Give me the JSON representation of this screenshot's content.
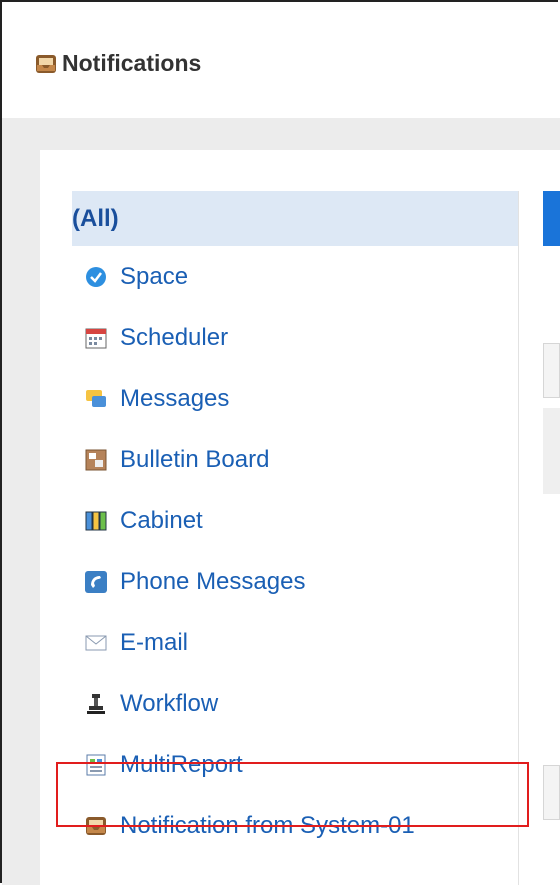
{
  "header": {
    "title": "Notifications",
    "icon": "notification-tray-icon"
  },
  "categories": [
    {
      "label": "(All)",
      "icon": "",
      "selected": true
    },
    {
      "label": "Space",
      "icon": "space-icon"
    },
    {
      "label": "Scheduler",
      "icon": "scheduler-icon"
    },
    {
      "label": "Messages",
      "icon": "messages-icon"
    },
    {
      "label": "Bulletin Board",
      "icon": "bulletin-board-icon"
    },
    {
      "label": "Cabinet",
      "icon": "cabinet-icon"
    },
    {
      "label": "Phone Messages",
      "icon": "phone-messages-icon"
    },
    {
      "label": "E-mail",
      "icon": "email-icon"
    },
    {
      "label": "Workflow",
      "icon": "workflow-icon"
    },
    {
      "label": "MultiReport",
      "icon": "multireport-icon"
    },
    {
      "label": "Notification from System-01",
      "icon": "notification-tray-icon",
      "highlighted": true
    }
  ],
  "colors": {
    "accent": "#1a74d9",
    "highlight": "#e11d1d",
    "selected_bg": "#dde8f5"
  }
}
